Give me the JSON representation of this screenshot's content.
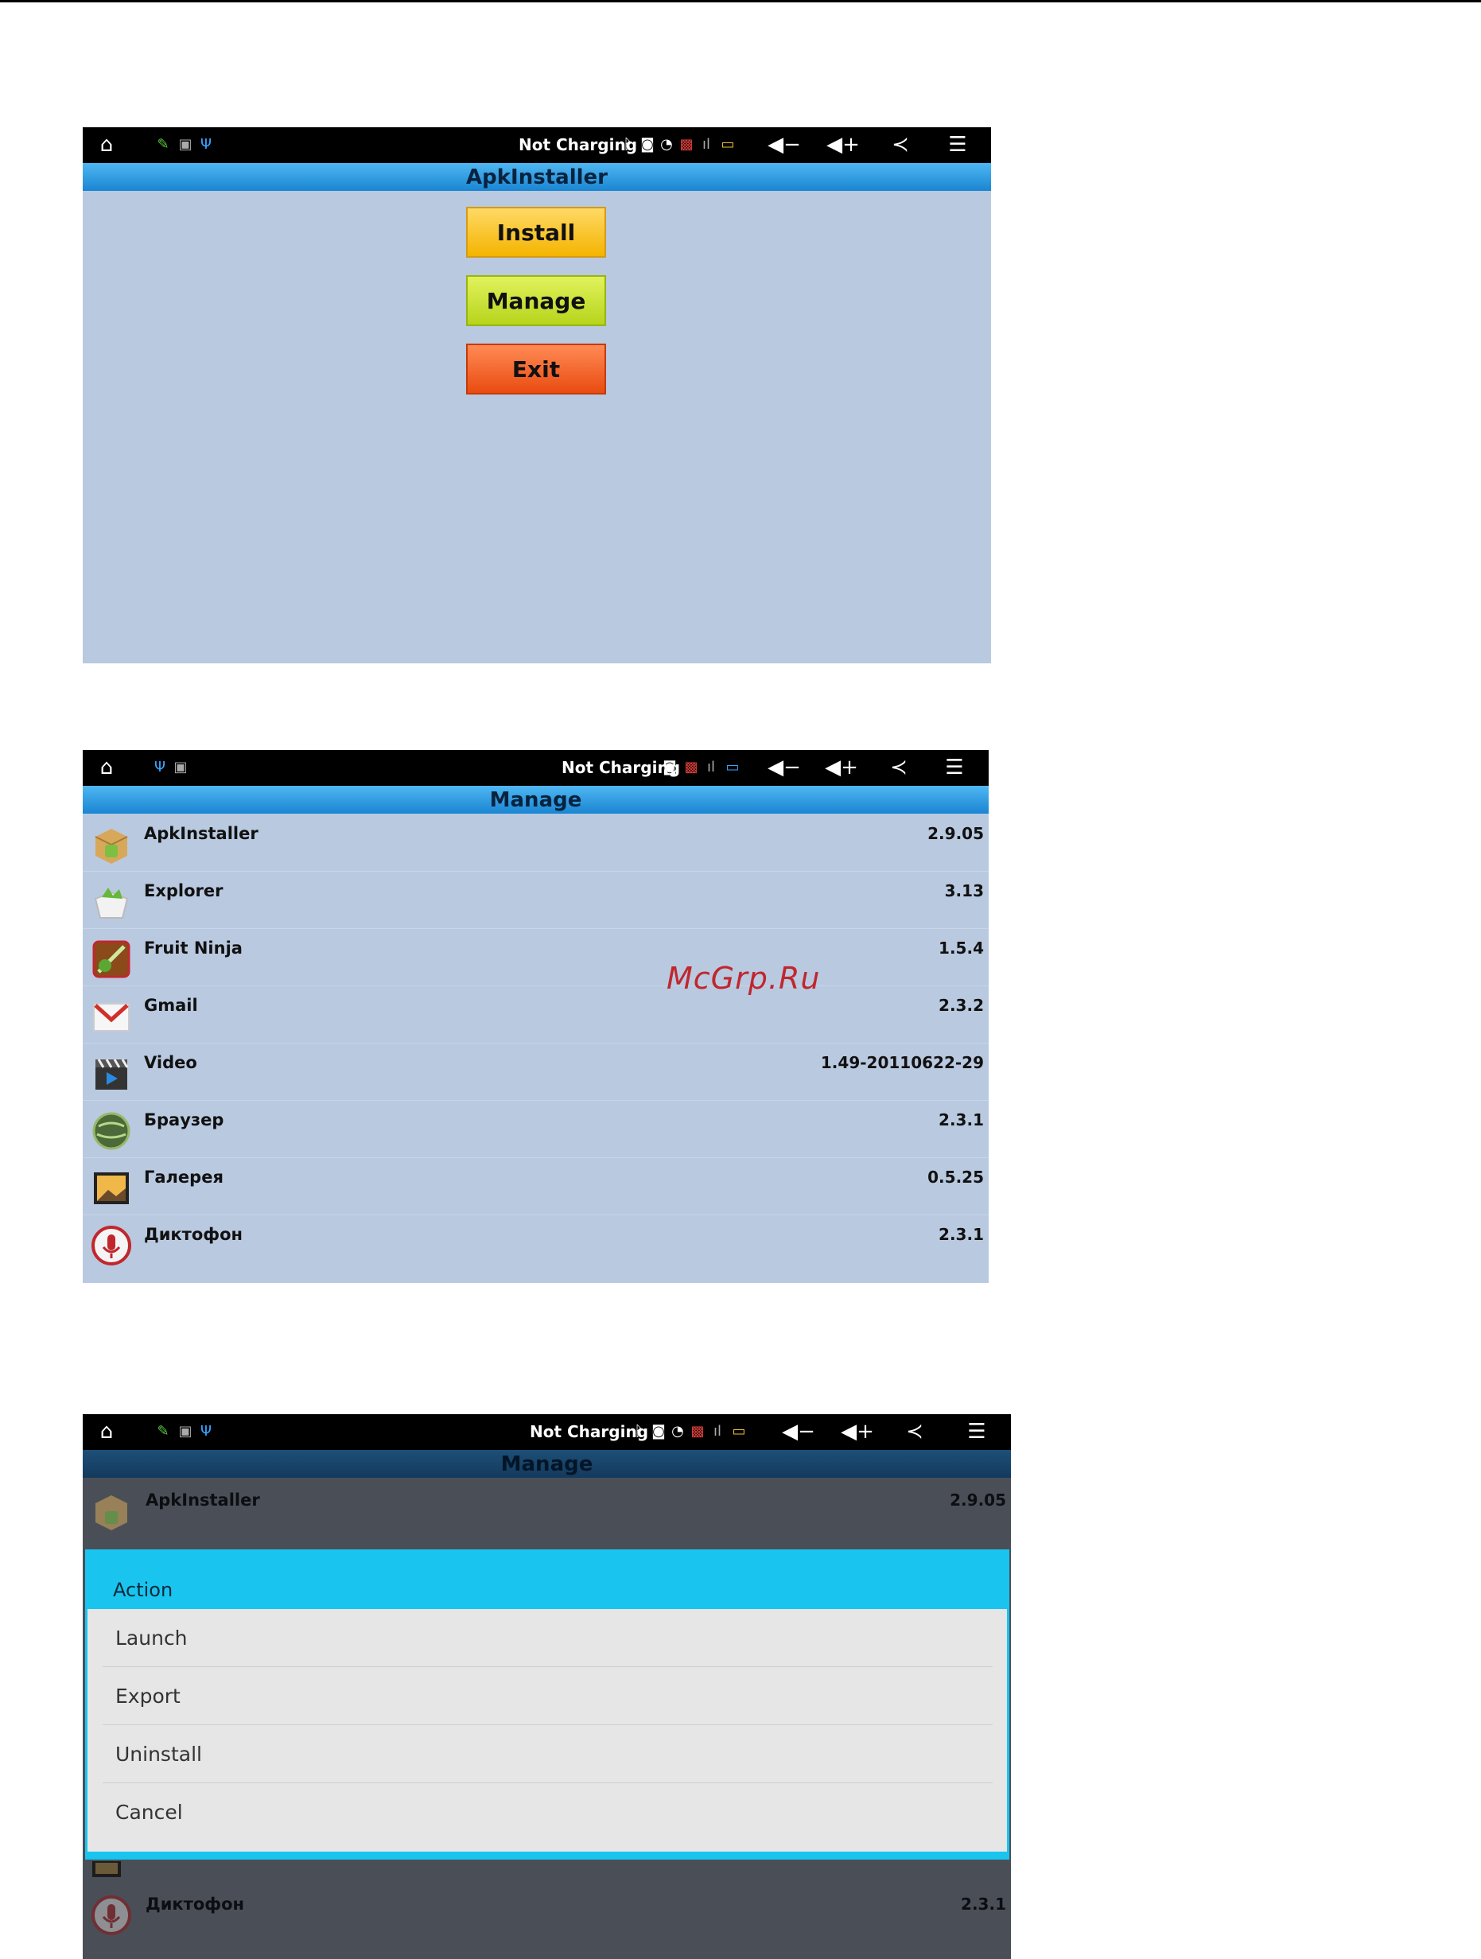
{
  "status": {
    "text": "Not Charging"
  },
  "screen1": {
    "title": "ApkInstaller",
    "buttons": {
      "install": "Install",
      "manage": "Manage",
      "exit": "Exit"
    }
  },
  "screen2": {
    "title": "Manage",
    "apps": [
      {
        "name": "ApkInstaller",
        "version": "2.9.05",
        "icon": "apk-package-icon"
      },
      {
        "name": "Explorer",
        "version": "3.13",
        "icon": "explorer-icon"
      },
      {
        "name": "Fruit Ninja",
        "version": "1.5.4",
        "icon": "fruit-ninja-icon"
      },
      {
        "name": "Gmail",
        "version": "2.3.2",
        "icon": "gmail-icon"
      },
      {
        "name": "Video",
        "version": "1.49-20110622-29",
        "icon": "video-clapper-icon"
      },
      {
        "name": "Браузер",
        "version": "2.3.1",
        "icon": "browser-globe-icon"
      },
      {
        "name": "Галерея",
        "version": "0.5.25",
        "icon": "gallery-icon"
      },
      {
        "name": "Диктофон",
        "version": "2.3.1",
        "icon": "microphone-icon"
      }
    ]
  },
  "screen3": {
    "title": "Manage",
    "apps": [
      {
        "name": "ApkInstaller",
        "version": "2.9.05",
        "icon": "apk-package-icon"
      },
      {
        "name": "Диктофон",
        "version": "2.3.1",
        "icon": "microphone-icon"
      }
    ],
    "dialog": {
      "title": "Action",
      "items": [
        "Launch",
        "Export",
        "Uninstall",
        "Cancel"
      ]
    }
  },
  "watermark": "McGrp.Ru",
  "colors": {
    "statusbar": "#000000",
    "titlebar": "#2a9ae0",
    "background": "#b9c9e0",
    "dialog_accent": "#19c4ef",
    "install": "#f4b400",
    "manage": "#b7d41c",
    "exit": "#e94c10"
  }
}
